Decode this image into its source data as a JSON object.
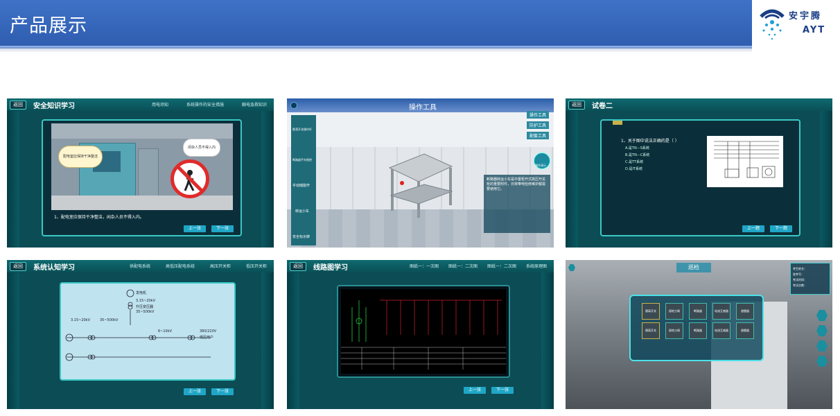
{
  "header": {
    "title": "产品展示"
  },
  "logo": {
    "name": "安宇腾",
    "abbr": "AYT"
  },
  "panels": {
    "p1": {
      "back": "返回",
      "title": "安全知识学习",
      "nav": [
        "用电须知",
        "系统操作的安全措施",
        "触电急救知识"
      ],
      "bubble_left": "配电室应保持干净整洁",
      "bubble_right": "闲杂人员不得入内",
      "caption": "1、配电室应保持干净整洁，闲杂人员不得入内。",
      "prev": "上一张",
      "next": "下一张"
    },
    "p2": {
      "title": "操作工具",
      "right_menu": [
        "操作工具",
        "防护工具",
        "配套工具"
      ],
      "tools": [
        "跌落开关操作杆",
        "断路器手车摇把",
        "手动储能杆",
        "转运小车",
        "安全标示牌"
      ],
      "detail_label": "操作演示",
      "description": "断路器转运小车是中置柜开式高压开关柜的重要附件，日常带电检修维护都需要使用它。"
    },
    "p3": {
      "back": "返回",
      "title": "试卷二",
      "question": "1、关于图中说法正确的是（    ）",
      "options": [
        "A.是TN－S系统",
        "B.是TN－C系统",
        "C.是TT系统",
        "D.是IT系统"
      ],
      "prev": "上一题",
      "next": "下一题"
    },
    "p4": {
      "back": "返回",
      "title": "系统认知学习",
      "nav": [
        "供配电系统",
        "高低压配电系统",
        "高压开关柜",
        "低压开关柜"
      ],
      "diagram_labels": [
        "发电机",
        "3.15~20kV",
        "升压变压器",
        "35~500kV",
        "3.15~20kV",
        "35~500kV",
        "6~10kV",
        "380/220V",
        "低压用户"
      ],
      "prev": "上一张",
      "next": "下一张"
    },
    "p5": {
      "back": "返回",
      "title": "线路图学习",
      "nav": [
        "图纸一：一次图",
        "图纸一：二次图",
        "图纸一：二次图",
        "系统原理图"
      ],
      "prev": "上一张",
      "next": "下一张"
    },
    "p6": {
      "title": "巡检",
      "info": [
        "考生姓名：",
        "准考号：",
        "考试时间：",
        "考试次数："
      ],
      "tiles": [
        "隔离开关",
        "接地刀闸",
        "断路器",
        "电流互感器",
        "避雷器",
        "隔离开关",
        "接地刀闸",
        "断路器",
        "电流互感器",
        "避雷器"
      ]
    }
  },
  "colors": {
    "header_bg": "#3567bd",
    "panel_bg": "#0c4c55",
    "accent": "#3bc8c6",
    "button": "#1fa6c6"
  }
}
